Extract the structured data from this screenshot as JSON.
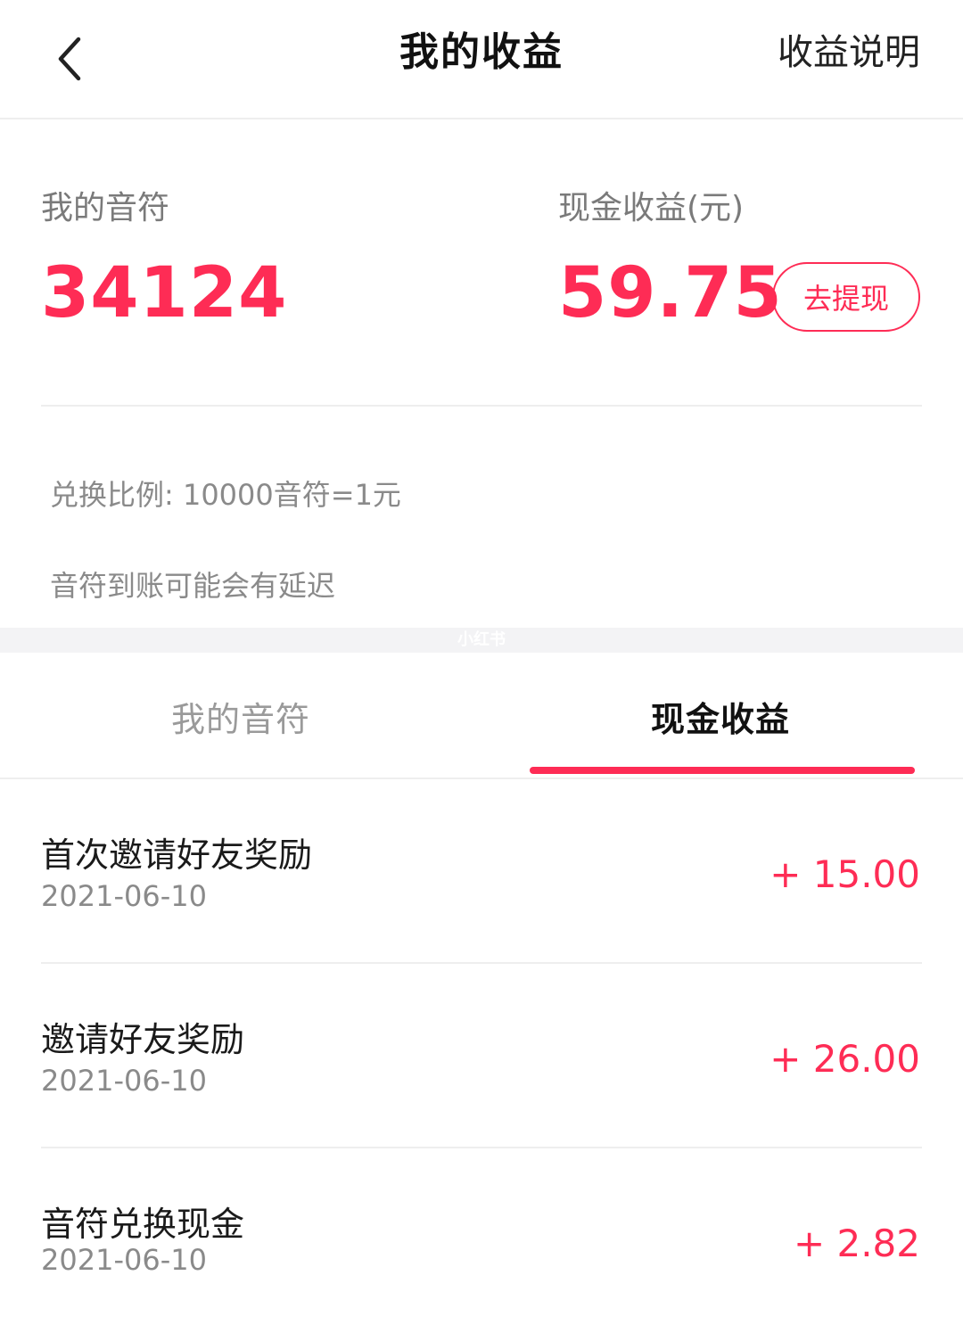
{
  "nav": {
    "title": "我的收益",
    "right_label": "收益说明",
    "back_icon": "chevron-left-icon"
  },
  "summary": {
    "notes_label": "我的音符",
    "notes_value": "34124",
    "cash_label": "现金收益(元)",
    "cash_value": "59.75",
    "withdraw_label": "去提现",
    "exchange_rate": "兑换比例: 10000音符=1元",
    "delay_note": "音符到账可能会有延迟"
  },
  "watermark": "小红书",
  "tabs": {
    "items": [
      {
        "label": "我的音符",
        "active": false
      },
      {
        "label": "现金收益",
        "active": true
      }
    ]
  },
  "records": [
    {
      "title": "首次邀请好友奖励",
      "date": "2021-06-10",
      "amount": "+ 15.00"
    },
    {
      "title": "邀请好友奖励",
      "date": "2021-06-10",
      "amount": "+ 26.00"
    },
    {
      "title": "音符兑换现金",
      "date": "2021-06-10",
      "amount": "+ 2.82"
    }
  ],
  "colors": {
    "accent": "#fe2c55",
    "muted_text": "#8a8a8a",
    "divider": "#eeeeee"
  }
}
